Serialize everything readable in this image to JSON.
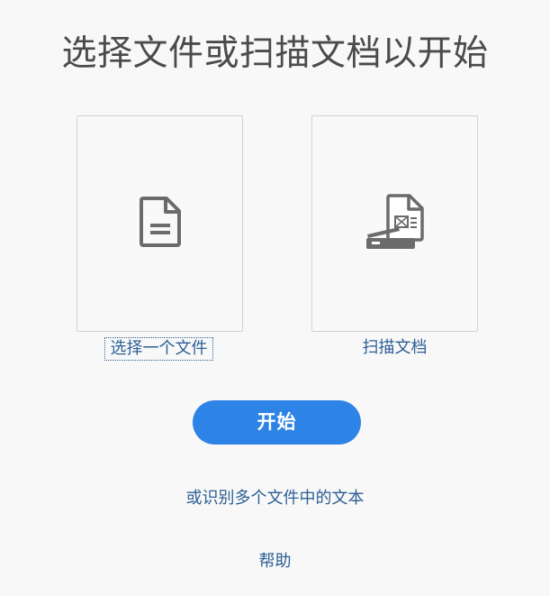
{
  "header": {
    "title": "选择文件或扫描文档以开始"
  },
  "options": {
    "select_file": {
      "label": "选择一个文件",
      "icon": "document-icon"
    },
    "scan_document": {
      "label": "扫描文档",
      "icon": "scanner-icon"
    }
  },
  "actions": {
    "start_label": "开始",
    "multi_files_label": "或识别多个文件中的文本",
    "help_label": "帮助"
  },
  "colors": {
    "background": "#f8f8f8",
    "primary_button": "#2e83e6",
    "link": "#2d5f95",
    "title": "#4b4b4b",
    "icon": "#6b6b6b"
  }
}
